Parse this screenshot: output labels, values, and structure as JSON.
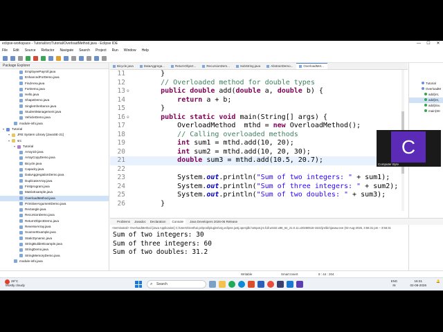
{
  "window": {
    "title": "eclipse-workspace - Tutorial/src/Tutorial/OverloadMethod.java - Eclipse IDE",
    "controls": [
      "—",
      "☐",
      "✕"
    ]
  },
  "menu": [
    "File",
    "Edit",
    "Source",
    "Refactor",
    "Navigate",
    "Search",
    "Project",
    "Run",
    "Window",
    "Help"
  ],
  "explorer": {
    "title": "Package Explorer",
    "items": [
      {
        "label": "EmployeePayroll.java",
        "depth": 3,
        "kind": "java"
      },
      {
        "label": "EnhancedForDemo.java",
        "depth": 3,
        "kind": "java"
      },
      {
        "label": "FindArea.java",
        "depth": 3,
        "kind": "java"
      },
      {
        "label": "ForDemo.java",
        "depth": 3,
        "kind": "java"
      },
      {
        "label": "Hello.java",
        "depth": 3,
        "kind": "java"
      },
      {
        "label": "ShapeDemo.java",
        "depth": 3,
        "kind": "java"
      },
      {
        "label": "SingleInheritance.java",
        "depth": 3,
        "kind": "java"
      },
      {
        "label": "StudentManagement.java",
        "depth": 3,
        "kind": "java"
      },
      {
        "label": "VehicleDemo.java",
        "depth": 3,
        "kind": "java"
      },
      {
        "label": "module-info.java",
        "depth": 2,
        "kind": "java"
      },
      {
        "label": "Tutorial",
        "depth": 0,
        "kind": "proj"
      },
      {
        "label": "JRE System Library [JavaSE-21]",
        "depth": 1,
        "kind": "folder"
      },
      {
        "label": "src",
        "depth": 1,
        "kind": "folder"
      },
      {
        "label": "Tutorial",
        "depth": 2,
        "kind": "pkg"
      },
      {
        "label": "Array1D.java",
        "depth": 3,
        "kind": "java"
      },
      {
        "label": "ArrayCopyDemo.java",
        "depth": 3,
        "kind": "java"
      },
      {
        "label": "Bicycle.java",
        "depth": 3,
        "kind": "java"
      },
      {
        "label": "Capacity.java",
        "depth": 3,
        "kind": "java"
      },
      {
        "label": "DataAggregationDemo.java",
        "depth": 3,
        "kind": "java"
      },
      {
        "label": "DuplicateArray.java",
        "depth": 3,
        "kind": "java"
      },
      {
        "label": "Firstprogram.java",
        "depth": 3,
        "kind": "java"
      },
      {
        "label": "MatrixExample.java",
        "depth": 3,
        "kind": "java"
      },
      {
        "label": "OverloadMethod.java",
        "depth": 3,
        "kind": "java",
        "selected": true
      },
      {
        "label": "PrimitiveArgumentDemo.java",
        "depth": 3,
        "kind": "java"
      },
      {
        "label": "Rectangle.java",
        "depth": 3,
        "kind": "java"
      },
      {
        "label": "RecursionDemo.java",
        "depth": 3,
        "kind": "java"
      },
      {
        "label": "ReturnObjectDemo.java",
        "depth": 3,
        "kind": "java"
      },
      {
        "label": "ReverseArray.java",
        "depth": 3,
        "kind": "java"
      },
      {
        "label": "ScannerExample.java",
        "depth": 3,
        "kind": "java"
      },
      {
        "label": "StaticDynamic.java",
        "depth": 3,
        "kind": "java"
      },
      {
        "label": "StringBuilderExample.java",
        "depth": 3,
        "kind": "java"
      },
      {
        "label": "StringDemo.java",
        "depth": 3,
        "kind": "java"
      },
      {
        "label": "StringMemoryDemo.java",
        "depth": 3,
        "kind": "java"
      },
      {
        "label": "module-info.java",
        "depth": 2,
        "kind": "java"
      }
    ]
  },
  "editor_tabs": [
    {
      "label": "Bicycle.java"
    },
    {
      "label": "DataAggrega..."
    },
    {
      "label": "ReturnObject..."
    },
    {
      "label": "RecursionDem..."
    },
    {
      "label": "SubString.java"
    },
    {
      "label": "AbstractDemo..."
    },
    {
      "label": "OverloadMet...",
      "active": true
    }
  ],
  "code": [
    {
      "n": "11",
      "segs": [
        [
          "p",
          "    }"
        ]
      ]
    },
    {
      "n": "12",
      "segs": [
        [
          "p",
          "    "
        ],
        [
          "cm",
          "// Overloaded method for double types"
        ]
      ]
    },
    {
      "n": "13",
      "fold": "⊖",
      "segs": [
        [
          "p",
          "    "
        ],
        [
          "kw",
          "public double"
        ],
        [
          "p",
          " add("
        ],
        [
          "kw",
          "double"
        ],
        [
          "p",
          " a, "
        ],
        [
          "kw",
          "double"
        ],
        [
          "p",
          " b) {"
        ]
      ]
    },
    {
      "n": "14",
      "segs": [
        [
          "p",
          "        "
        ],
        [
          "kw",
          "return"
        ],
        [
          "p",
          " a + b;"
        ]
      ]
    },
    {
      "n": "15",
      "segs": [
        [
          "p",
          "    }"
        ]
      ]
    },
    {
      "n": "16",
      "segs": [
        [
          "kw",
          "    public static void"
        ],
        [
          "p",
          " main(String[] args) {"
        ]
      ],
      "fold": "⊖"
    },
    {
      "n": "17",
      "segs": [
        [
          "p",
          "        OverloadMethod  mthd = "
        ],
        [
          "kw",
          "new"
        ],
        [
          "p",
          " OverloadMethod();"
        ]
      ]
    },
    {
      "n": "18",
      "segs": [
        [
          "p",
          "        "
        ],
        [
          "cm",
          "// Calling overloaded methods"
        ]
      ]
    },
    {
      "n": "19",
      "segs": [
        [
          "p",
          "        "
        ],
        [
          "kw",
          "int"
        ],
        [
          "p",
          " sum1 = mthd.add(10, 20);"
        ]
      ]
    },
    {
      "n": "20",
      "segs": [
        [
          "p",
          "        "
        ],
        [
          "kw",
          "int"
        ],
        [
          "p",
          " sum2 = mthd.add(10, 20, 30);"
        ]
      ]
    },
    {
      "n": "21",
      "segs": [
        [
          "p",
          "        "
        ],
        [
          "kw",
          "double"
        ],
        [
          "p",
          " sum3 = mthd.add(10.5, 20.7);"
        ]
      ],
      "hl": true
    },
    {
      "n": "22",
      "segs": [
        [
          "p",
          ""
        ]
      ]
    },
    {
      "n": "23",
      "segs": [
        [
          "p",
          "        System."
        ],
        [
          "fld",
          "out"
        ],
        [
          "p",
          ".println("
        ],
        [
          "st",
          "\"Sum of two integers: \""
        ],
        [
          "p",
          " + sum1);"
        ]
      ]
    },
    {
      "n": "24",
      "segs": [
        [
          "p",
          "        System."
        ],
        [
          "fld",
          "out"
        ],
        [
          "p",
          ".println("
        ],
        [
          "st",
          "\"Sum of three integers: \""
        ],
        [
          "p",
          " + sum2);"
        ]
      ]
    },
    {
      "n": "25",
      "segs": [
        [
          "p",
          "        System."
        ],
        [
          "fld",
          "out"
        ],
        [
          "p",
          ".println("
        ],
        [
          "st",
          "\"Sum of two doubles: \""
        ],
        [
          "p",
          " + sum3);"
        ]
      ]
    },
    {
      "n": "26",
      "segs": [
        [
          "p",
          "    }"
        ]
      ]
    }
  ],
  "outline": {
    "items": [
      "Tutorial",
      "OverloadM",
      "add(int,",
      "add(int,",
      "add(dou",
      "main(Str"
    ]
  },
  "console": {
    "tabs": [
      "Problems",
      "Javadoc",
      "Declaration",
      "Console",
      "Java Developers 2026-06 Release"
    ],
    "active_tab": "Console",
    "terminated": "<terminated> OverloadMethod [Java Application] C:\\Users\\Geetha\\.p2\\pool\\plugins\\org.eclipse.justj.openjdk.hotspot.jre.full.win32.x86_64_21.0.11.v20260515-1531\\jre\\bin\\javaw.exe  (02-Aug-2026, 3:56:31 pm – 3:56:31",
    "output": [
      "Sum of two integers: 30",
      "Sum of three integers: 60",
      "Sum of two doubles: 31.2"
    ]
  },
  "status": {
    "mode": "Writable",
    "insert": "Smart Insert",
    "position": "8 : 44 : 204"
  },
  "taskbar": {
    "weather_temp": "29°C",
    "weather_desc": "Mostly cloudy",
    "search_placeholder": "Search",
    "lang_top": "ENG",
    "lang_bottom": "IN",
    "time": "16:31",
    "date": "02-08-2026"
  },
  "webcam": {
    "initial": "C",
    "caption": "Computer Byte"
  },
  "colors": {
    "keyword": "#7f0055",
    "comment": "#3f7f5f",
    "string": "#2a00ff",
    "accent": "#4a7fc4",
    "avatar": "#5b2bb7"
  }
}
